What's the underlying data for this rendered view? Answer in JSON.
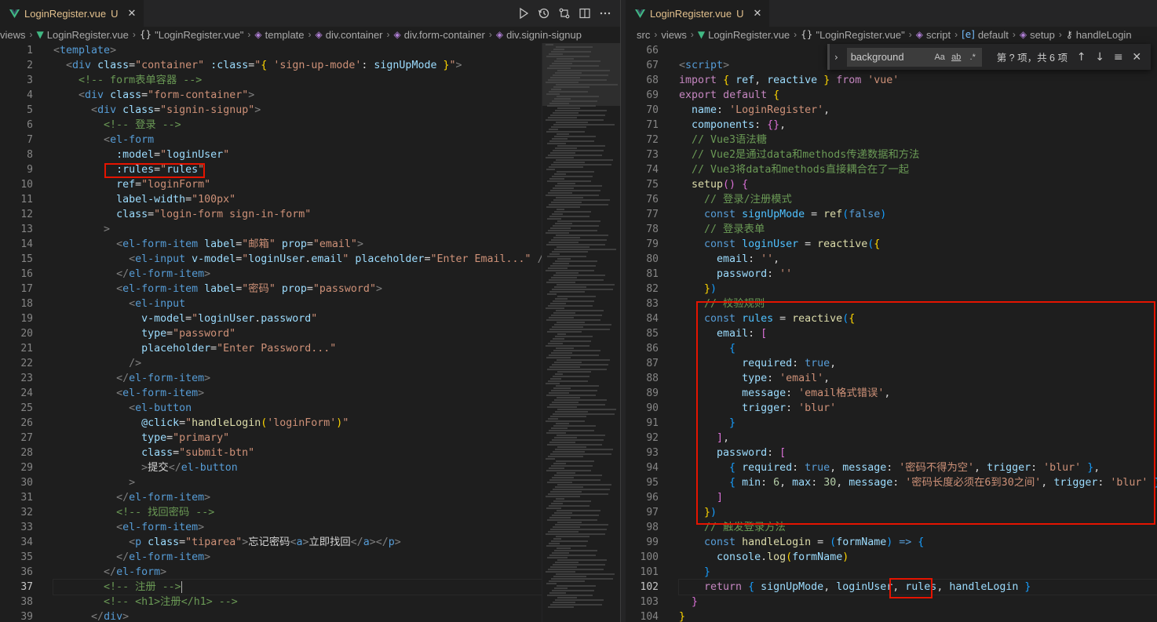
{
  "left": {
    "tab": {
      "name": "LoginRegister.vue",
      "status": "U",
      "close": "✕"
    },
    "breadcrumb": [
      "views",
      "LoginRegister.vue",
      "\"LoginRegister.vue\"",
      "template",
      "div.container",
      "div.form-container",
      "div.signin-signup"
    ],
    "line_numbers": [
      "1",
      "2",
      "3",
      "4",
      "5",
      "6",
      "7",
      "8",
      "9",
      "10",
      "11",
      "12",
      "13",
      "14",
      "15",
      "16",
      "17",
      "18",
      "19",
      "20",
      "21",
      "22",
      "23",
      "24",
      "25",
      "26",
      "27",
      "28",
      "29",
      "30",
      "31",
      "32",
      "33",
      "34",
      "35",
      "36",
      "37",
      "38",
      "39"
    ],
    "active_line": "37",
    "actions": [
      "run-icon",
      "history-icon",
      "compare-icon",
      "split-icon",
      "more-icon"
    ]
  },
  "right": {
    "tab": {
      "name": "LoginRegister.vue",
      "status": "U",
      "close": "✕"
    },
    "breadcrumb": [
      "src",
      "views",
      "LoginRegister.vue",
      "\"LoginRegister.vue\"",
      "script",
      "default",
      "setup",
      "handleLogin"
    ],
    "line_numbers": [
      "66",
      "67",
      "68",
      "69",
      "70",
      "71",
      "72",
      "73",
      "74",
      "75",
      "76",
      "77",
      "78",
      "79",
      "80",
      "81",
      "82",
      "83",
      "84",
      "85",
      "86",
      "87",
      "88",
      "89",
      "90",
      "91",
      "92",
      "93",
      "94",
      "95",
      "96",
      "97",
      "98",
      "99",
      "100",
      "101",
      "102",
      "103",
      "104"
    ],
    "active_line": "102",
    "find": {
      "value": "background",
      "options": [
        "Aa",
        "ab",
        ".*"
      ],
      "result": "第 ? 项，共 6 项",
      "prev": "↑",
      "next": "↓",
      "menu": "≡",
      "close": "✕"
    }
  },
  "colors": {
    "editor_bg": "#1e1e1e",
    "tag": "#569cd6",
    "attr": "#9cdcfe",
    "string": "#ce9178",
    "comment": "#6a9955",
    "keyword": "#c586c0",
    "function": "#dcdcaa",
    "highlight_box": "#e51400",
    "modified_tab": "#e2c08d"
  }
}
